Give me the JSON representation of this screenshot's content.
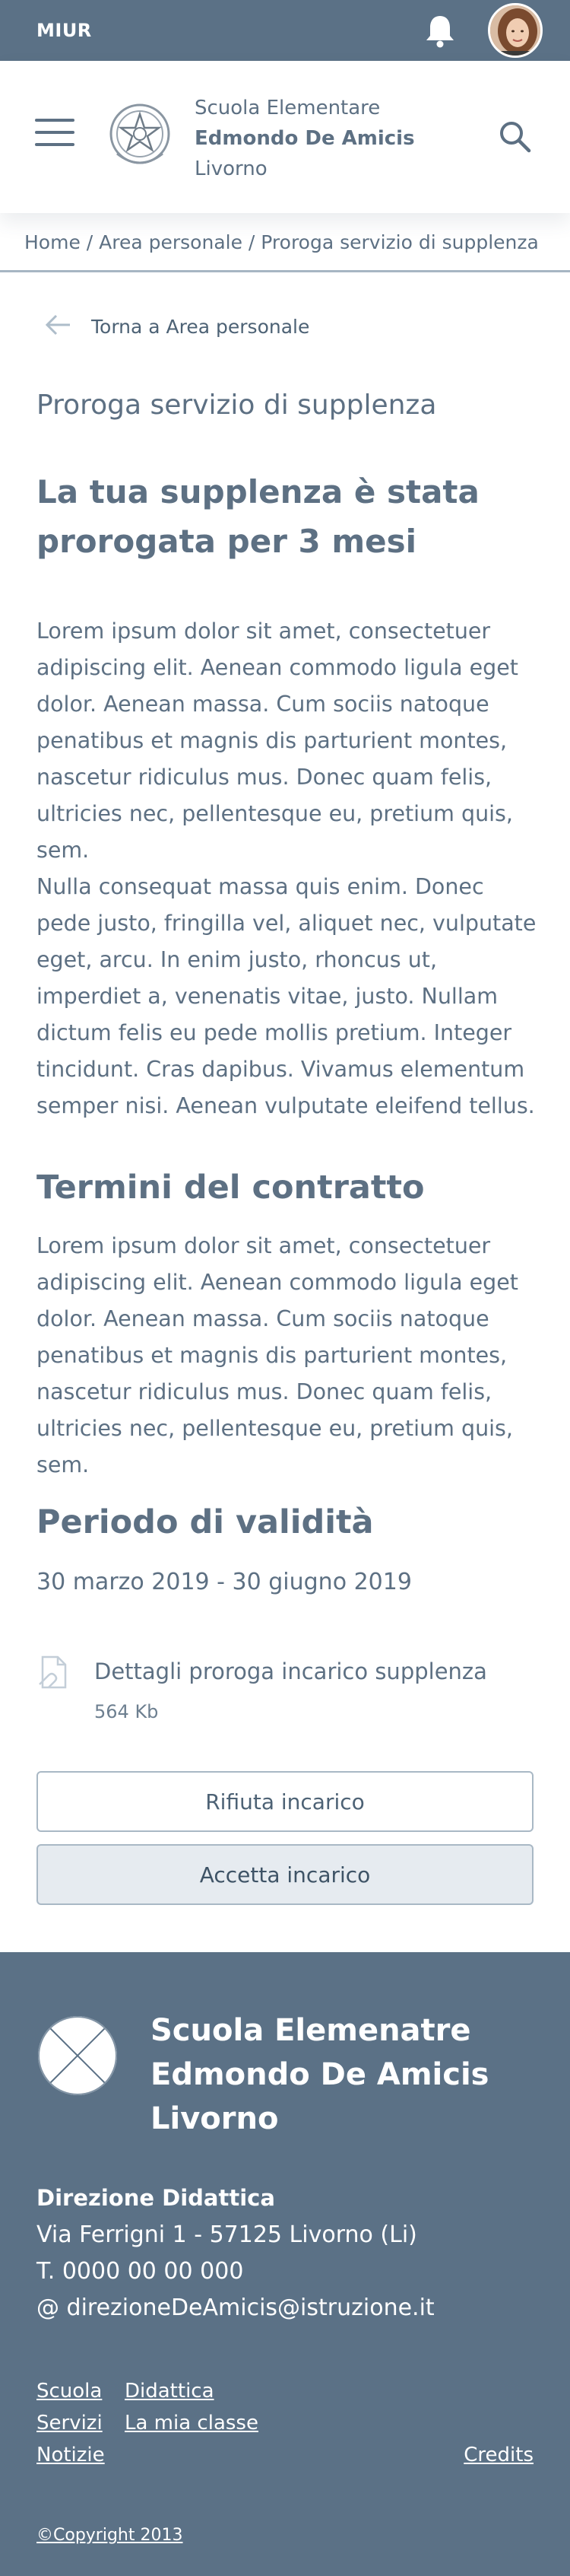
{
  "topbar": {
    "brand": "MIUR"
  },
  "header": {
    "school_line1": "Scuola Elementare",
    "school_line2": "Edmondo De Amicis",
    "school_line3": "Livorno"
  },
  "breadcrumb": "Home / Area personale / Proroga servizio di supplenza",
  "back_label": "Torna a Area personale",
  "subtitle": "Proroga servizio di supplenza",
  "headline": "La tua supplenza è stata prorogata per 3 mesi",
  "paragraphs": [
    "Lorem ipsum dolor sit amet, consectetuer adipiscing elit. Aenean commodo ligula eget dolor. Aenean massa. Cum sociis natoque penatibus et magnis dis parturient montes, nascetur ridiculus mus. Donec quam felis, ultricies nec, pellentesque eu, pretium quis, sem.",
    "Nulla consequat massa quis enim. Donec pede justo, fringilla vel, aliquet nec, vulputate eget, arcu. In enim justo, rhoncus ut, imperdiet a, venenatis vitae, justo. Nullam dictum felis eu pede mollis pretium. Integer tincidunt. Cras dapibus. Vivamus elementum semper nisi. Aenean vulputate eleifend tellus."
  ],
  "terms": {
    "title": "Termini del contratto",
    "text": "Lorem ipsum dolor sit amet, consectetuer adipiscing elit. Aenean commodo ligula eget dolor. Aenean massa. Cum sociis natoque penatibus et magnis dis parturient montes, nascetur ridiculus mus. Donec quam felis, ultricies nec, pellentesque eu, pretium quis, sem."
  },
  "validity": {
    "title": "Periodo di validità",
    "dates": "30 marzo 2019 - 30 giugno 2019"
  },
  "attachment": {
    "name": "Dettagli proroga incarico supplenza",
    "size": "564 Kb"
  },
  "buttons": {
    "reject": "Rifiuta incarico",
    "accept": "Accetta incarico"
  },
  "footer": {
    "name_line1": "Scuola Elemenatre",
    "name_line2": "Edmondo De Amicis",
    "name_line3": "Livorno",
    "direction_title": "Direzione Didattica",
    "address": "Via Ferrigni 1 - 57125 Livorno (Li)",
    "phone": "T. 0000 00 00 000",
    "email": "@ direzioneDeAmicis@istruzione.it",
    "links": {
      "scuola": "Scuola",
      "didattica": "Didattica",
      "servizi": "Servizi",
      "mia_classe": "La mia classe",
      "notizie": "Notizie",
      "credits": "Credits"
    },
    "copyright": "©Copyright 2013"
  },
  "colors": {
    "primary": "#5b7186",
    "text": "#5d7083",
    "button_accept_bg": "#e6ebf0",
    "border": "#a9b8c5"
  }
}
